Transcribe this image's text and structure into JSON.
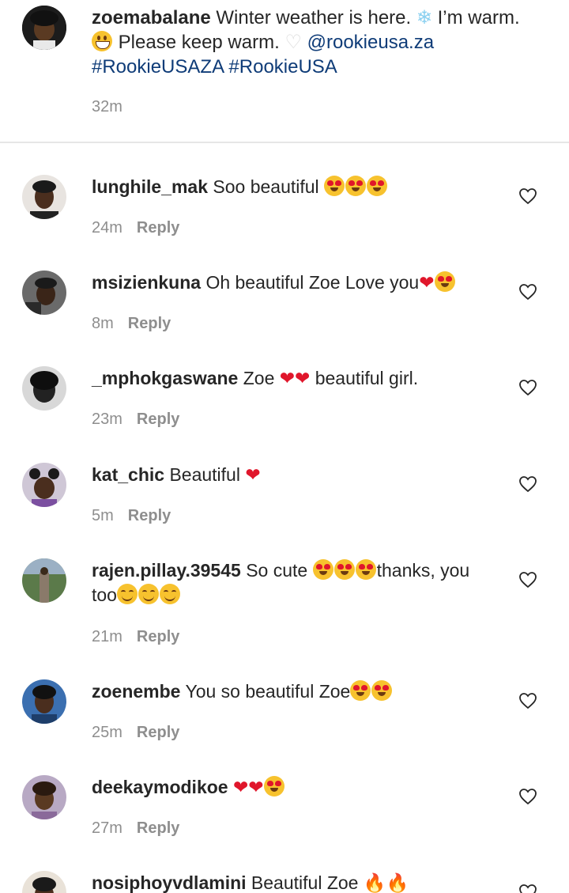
{
  "caption": {
    "username": "zoemabalane",
    "text_1": "Winter weather is here.",
    "emoji_snowflake": "❄",
    "text_2": "I’m warm.",
    "text_3": "Please keep warm.",
    "emoji_white_heart": "♡",
    "mention": "@rookieusa.za",
    "hashtags": "#RookieUSAZA #RookieUSA",
    "time": "32m"
  },
  "reply_label": "Reply",
  "comments": [
    {
      "username": "lunghile_mak",
      "text": "Soo beautiful",
      "emojis": [
        "love",
        "love",
        "love"
      ],
      "time": "24m"
    },
    {
      "username": "msizienkuna",
      "text": "Oh beautiful Zoe Love you",
      "emojis": [
        "heart",
        "love"
      ],
      "time": "8m"
    },
    {
      "username": "_mphokgaswane",
      "text_a": "Zoe",
      "text_b": "beautiful girl.",
      "time": "23m"
    },
    {
      "username": "kat_chic",
      "text": "Beautiful",
      "time": "5m"
    },
    {
      "username": "rajen.pillay.39545",
      "text_a": "So cute",
      "text_b": "thanks, you",
      "text_c": "too",
      "time": "21m"
    },
    {
      "username": "zoenembe",
      "text": "You so beautiful Zoe",
      "time": "25m"
    },
    {
      "username": "deekaymodikoe",
      "time": "27m"
    },
    {
      "username": "nosiphoyvdlamini",
      "text": "Beautiful Zoe"
    }
  ],
  "colors": {
    "accent_link": "#0f3c78",
    "meta_gray": "#8e8e8e",
    "heart_red": "#e0162b"
  }
}
